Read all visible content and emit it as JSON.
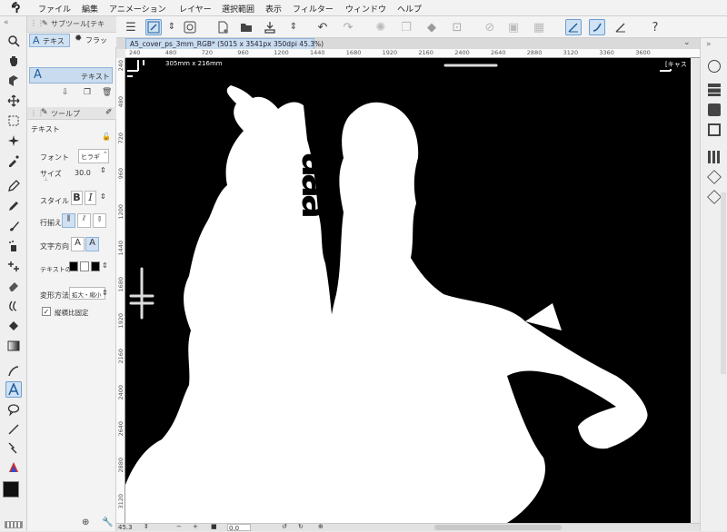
{
  "menubar": {
    "items": [
      "ファイル",
      "編集",
      "アニメーション",
      "レイヤー",
      "選択範囲",
      "表示",
      "フィルター",
      "ウィンドウ",
      "ヘルプ"
    ]
  },
  "subtool": {
    "header_tab": "サブツール[テキ",
    "tabs": [
      "テキス",
      "フラッ"
    ],
    "selected_tool": "テキスト",
    "detail_tab": "ツールプ",
    "section_title": "テキスト",
    "font_label": "フォント",
    "font_value": "ヒラギ",
    "size_label": "サイズ",
    "size_value": "30.0",
    "style_label": "スタイル",
    "style_bold": "B",
    "style_italic": "I",
    "align_label": "行揃え",
    "direction_label": "文字方向",
    "direction_h": "A",
    "direction_v": "A",
    "textcolor_label": "テキストの",
    "transform_label": "変形方法",
    "transform_value": "拡大・縮小",
    "ratio_checkbox_label": "縦横比固定"
  },
  "document": {
    "tab_title": "A5_cover_ps_3mm_RGB* (5015 x 3541px 350dpi 45.3%)",
    "canvas_size_label": "305mm x 216mm",
    "corner_label": "[キャス"
  },
  "ruler_top": [
    "240",
    "480",
    "720",
    "960",
    "1200",
    "1440",
    "1680",
    "1920",
    "2160",
    "2400",
    "2640",
    "2880",
    "3120",
    "3360",
    "3600"
  ],
  "ruler_left": [
    "240",
    "480",
    "720",
    "960",
    "1200",
    "1440",
    "1680",
    "1920",
    "2160",
    "2400",
    "2640",
    "2880",
    "3120"
  ],
  "canvas_text": "aaa",
  "statusbar": {
    "zoom": "45.3",
    "rotate": "0.0"
  },
  "colors": {
    "accent": "#4a86c5",
    "selected_bg": "#cfe1f2",
    "canvas_bg": "#000000",
    "silhouette": "#ffffff"
  }
}
